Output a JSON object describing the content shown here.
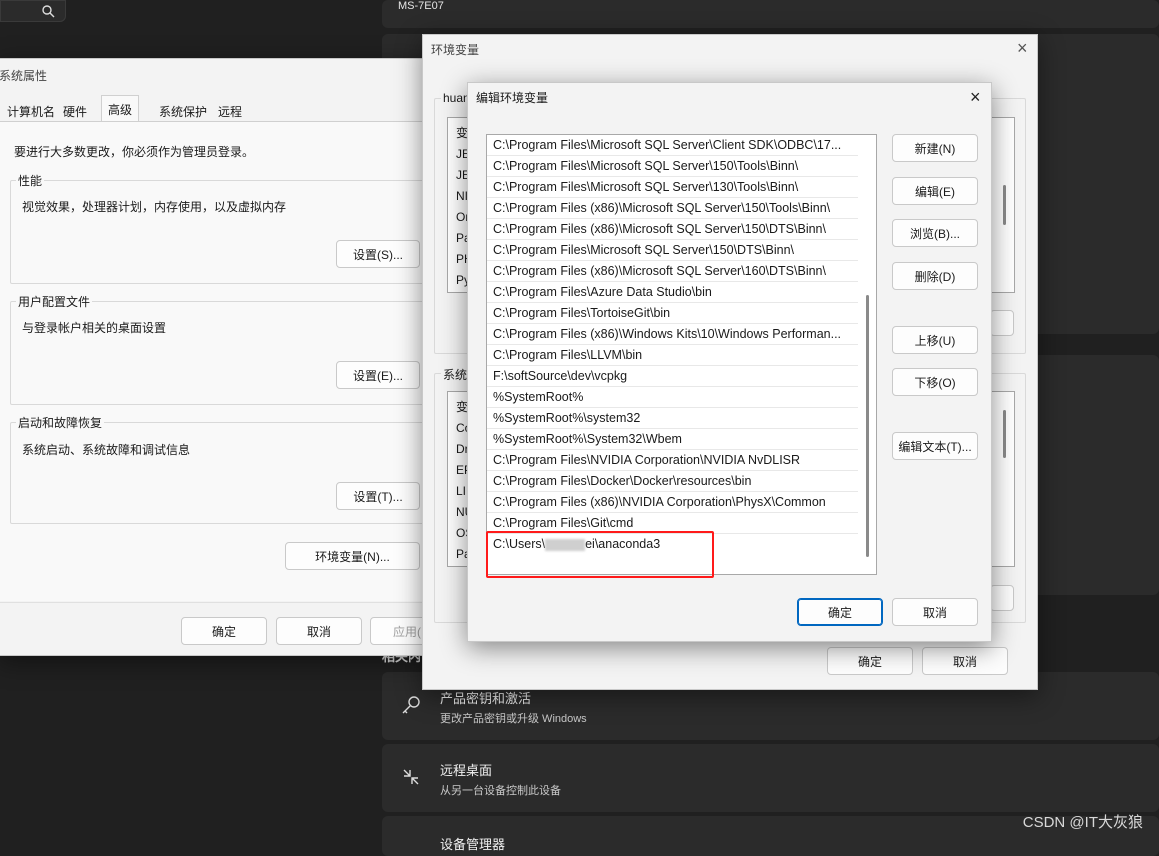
{
  "background": {
    "pc_name": "MS-7E07",
    "section_label": "相关内",
    "cards": [
      {
        "title": "产品密钥和激活",
        "subtitle": "更改产品密钥或升级 Windows",
        "icon": "key-icon"
      },
      {
        "title": "远程桌面",
        "subtitle": "从另一台设备控制此设备",
        "icon": "remote-desktop-icon"
      },
      {
        "title": "设备管理器",
        "subtitle": "",
        "icon": "device-icon"
      }
    ],
    "watermark": "CSDN @IT大灰狼"
  },
  "sysprops": {
    "title": "系统属性",
    "tabs": [
      "计算机名",
      "硬件",
      "高级",
      "系统保护",
      "远程"
    ],
    "active_tab": "高级",
    "admin_note": "要进行大多数更改，你必须作为管理员登录。",
    "performance": {
      "label": "性能",
      "desc": "视觉效果，处理器计划，内存使用，以及虚拟内存",
      "button": "设置(S)..."
    },
    "profiles": {
      "label": "用户配置文件",
      "desc": "与登录帐户相关的桌面设置",
      "button": "设置(E)..."
    },
    "startup": {
      "label": "启动和故障恢复",
      "desc": "系统启动、系统故障和调试信息",
      "button": "设置(T)..."
    },
    "env_button": "环境变量(N)...",
    "ok": "确定",
    "cancel": "取消",
    "apply": "应用("
  },
  "envvars": {
    "title": "环境变量",
    "user_group_label": "huan",
    "user_col": "变",
    "user_rows": [
      "JE",
      "JE",
      "NI",
      "Or",
      "Pa",
      "PH",
      "Py"
    ],
    "system_group_label": "系统",
    "system_col": "变",
    "system_rows": [
      "Co",
      "Dr",
      "EP",
      "LI",
      "NU",
      "OS",
      "Pa"
    ],
    "ok": "确定",
    "cancel": "取消"
  },
  "editenv": {
    "title": "编辑环境变量",
    "paths": [
      "C:\\Program Files\\Microsoft SQL Server\\Client SDK\\ODBC\\17...",
      "C:\\Program Files\\Microsoft SQL Server\\150\\Tools\\Binn\\",
      "C:\\Program Files\\Microsoft SQL Server\\130\\Tools\\Binn\\",
      "C:\\Program Files (x86)\\Microsoft SQL Server\\150\\Tools\\Binn\\",
      "C:\\Program Files (x86)\\Microsoft SQL Server\\150\\DTS\\Binn\\",
      "C:\\Program Files\\Microsoft SQL Server\\150\\DTS\\Binn\\",
      "C:\\Program Files (x86)\\Microsoft SQL Server\\160\\DTS\\Binn\\",
      "C:\\Program Files\\Azure Data Studio\\bin",
      "C:\\Program Files\\TortoiseGit\\bin",
      "C:\\Program Files (x86)\\Windows Kits\\10\\Windows Performan...",
      "C:\\Program Files\\LLVM\\bin",
      "F:\\softSource\\dev\\vcpkg",
      "%SystemRoot%",
      "%SystemRoot%\\system32",
      "%SystemRoot%\\System32\\Wbem",
      "C:\\Program Files\\NVIDIA Corporation\\NVIDIA NvDLISR",
      "C:\\Program Files\\Docker\\Docker\\resources\\bin",
      "C:\\Program Files (x86)\\NVIDIA Corporation\\PhysX\\Common",
      "C:\\Program Files\\Git\\cmd"
    ],
    "new_entry_prefix": "C:\\Users\\",
    "new_entry_suffix": "ei\\anaconda3",
    "buttons": {
      "new": "新建(N)",
      "edit": "编辑(E)",
      "browse": "浏览(B)...",
      "delete": "删除(D)",
      "up": "上移(U)",
      "down": "下移(O)",
      "edit_text": "编辑文本(T)..."
    },
    "ok": "确定",
    "cancel": "取消"
  }
}
